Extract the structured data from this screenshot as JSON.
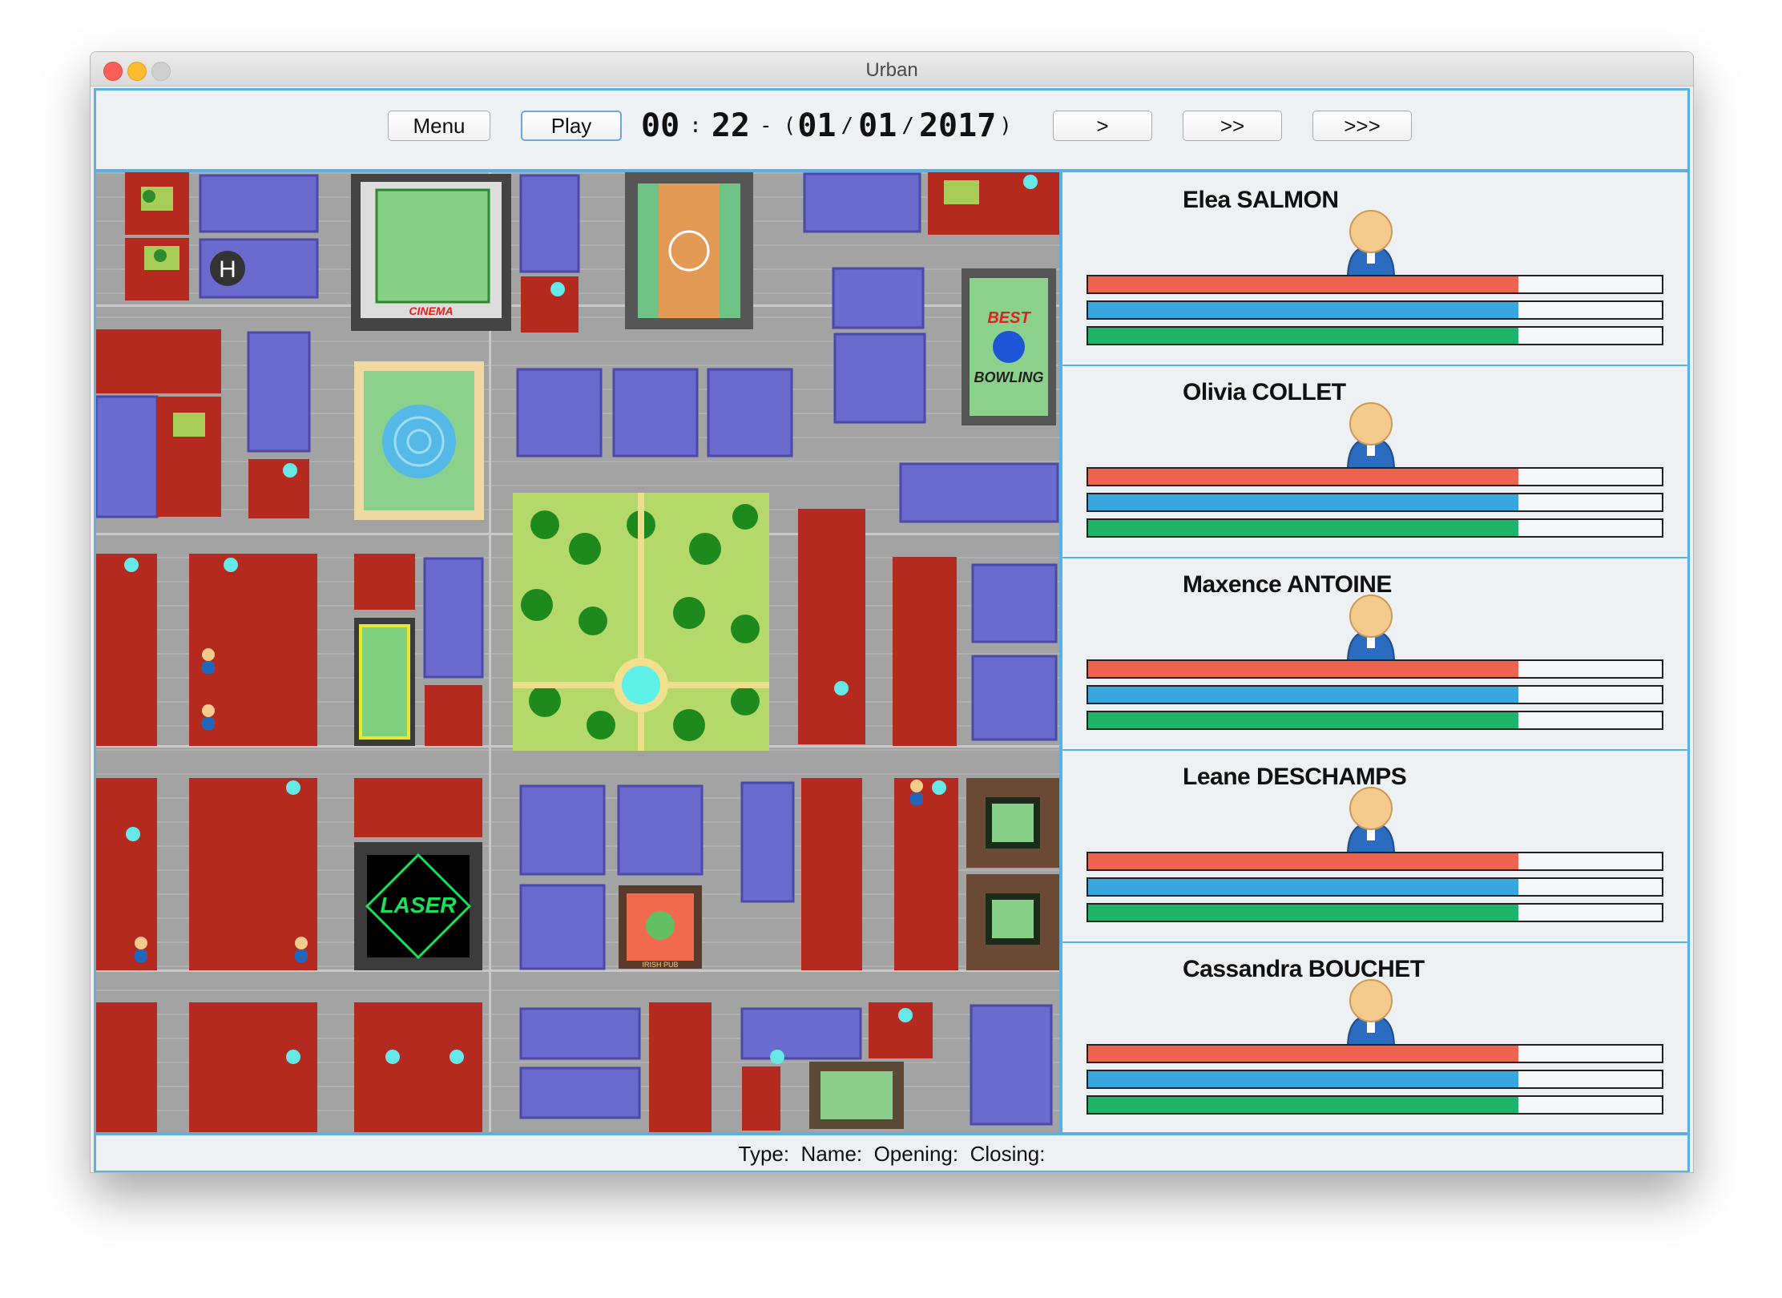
{
  "window": {
    "title": "Urban"
  },
  "toolbar": {
    "menu_label": "Menu",
    "play_label": "Play",
    "speed1_label": ">",
    "speed2_label": ">>",
    "speed3_label": ">>>"
  },
  "clock": {
    "hours": "00",
    "sep1": ":",
    "minutes": "22",
    "dash": "-",
    "open": "(",
    "day": "01",
    "slash1": "/",
    "month": "01",
    "slash2": "/",
    "year": "2017",
    "close": ")"
  },
  "map": {
    "cinema_label": "CINEMA",
    "bowling_label_1": "BEST",
    "bowling_label_2": "BOWLING",
    "laser_label": "LASER",
    "helipad_label": "H",
    "pub_label": "IRISH PUB"
  },
  "people": [
    {
      "name": "Elea SALMON",
      "bars": [
        0.75,
        0.75,
        0.75
      ]
    },
    {
      "name": "Olivia COLLET",
      "bars": [
        0.75,
        0.75,
        0.75
      ]
    },
    {
      "name": "Maxence ANTOINE",
      "bars": [
        0.75,
        0.75,
        0.75
      ]
    },
    {
      "name": "Leane DESCHAMPS",
      "bars": [
        0.75,
        0.75,
        0.75
      ]
    },
    {
      "name": "Cassandra BOUCHET",
      "bars": [
        0.75,
        0.75,
        0.75
      ]
    }
  ],
  "bar_colors": [
    "#ee6350",
    "#37a7e0",
    "#1db46c"
  ],
  "status": {
    "type_label": "Type:",
    "name_label": "Name:",
    "opening_label": "Opening:",
    "closing_label": "Closing:"
  }
}
